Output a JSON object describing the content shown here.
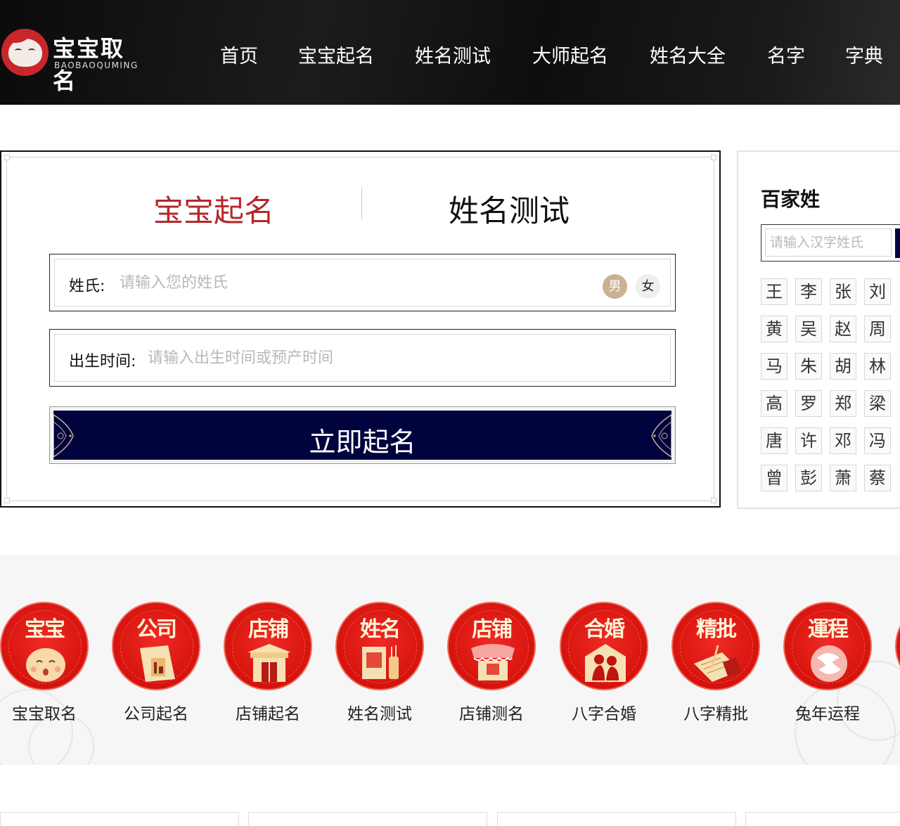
{
  "header": {
    "logo_title": "宝宝取名",
    "logo_sub": "BAOBAOQUMING",
    "nav": [
      {
        "label": "首页"
      },
      {
        "label": "宝宝起名"
      },
      {
        "label": "姓名测试"
      },
      {
        "label": "大师起名"
      },
      {
        "label": "姓名大全"
      },
      {
        "label": "名字"
      },
      {
        "label": "字典"
      }
    ]
  },
  "form": {
    "tabs": [
      {
        "label": "宝宝起名",
        "active": true
      },
      {
        "label": "姓名测试",
        "active": false
      }
    ],
    "surname_label": "姓氏:",
    "surname_placeholder": "请输入您的姓氏",
    "gender_male": "男",
    "gender_female": "女",
    "birth_label": "出生时间:",
    "birth_placeholder": "请输入出生时间或预产时间",
    "submit_label": "立即起名"
  },
  "surnames": {
    "title": "百家姓",
    "search_placeholder": "请输入汉字姓氏",
    "rows": [
      [
        "王",
        "李",
        "张",
        "刘"
      ],
      [
        "黄",
        "吴",
        "赵",
        "周"
      ],
      [
        "马",
        "朱",
        "胡",
        "林"
      ],
      [
        "高",
        "罗",
        "郑",
        "梁"
      ],
      [
        "唐",
        "许",
        "邓",
        "冯"
      ],
      [
        "曾",
        "彭",
        "萧",
        "蔡"
      ]
    ]
  },
  "services": [
    {
      "glyph": "宝宝",
      "label": "宝宝取名",
      "icon": "baby-face-icon"
    },
    {
      "glyph": "公司",
      "label": "公司起名",
      "icon": "company-icon"
    },
    {
      "glyph": "店铺",
      "label": "店铺起名",
      "icon": "shop-gate-icon"
    },
    {
      "glyph": "姓名",
      "label": "姓名测试",
      "icon": "name-test-icon"
    },
    {
      "glyph": "店铺",
      "label": "店铺测名",
      "icon": "shop-stall-icon"
    },
    {
      "glyph": "合婚",
      "label": "八字合婚",
      "icon": "couple-icon"
    },
    {
      "glyph": "精批",
      "label": "八字精批",
      "icon": "scroll-icon"
    },
    {
      "glyph": "運程",
      "label": "兔年运程",
      "icon": "fish-icon"
    }
  ],
  "colors": {
    "brand_red": "#b5282a",
    "navy": "#01033f",
    "male": "#c9b291"
  }
}
